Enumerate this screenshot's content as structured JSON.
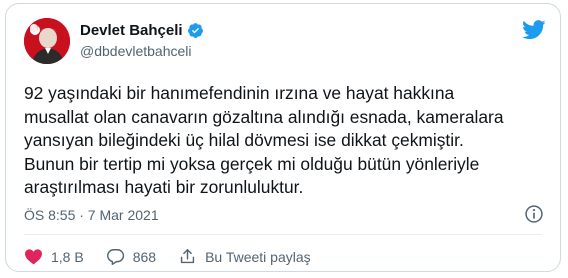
{
  "author": {
    "name": "Devlet Bahçeli",
    "handle": "@dbdevletbahceli"
  },
  "tweet": {
    "lines": [
      "92 yaşındaki bir hanımefendinin ırzına ve hayat hakkına",
      "musallat olan canavarın gözaltına alındığı esnada, kameralara",
      "yansıyan bileğindeki üç hilal dövmesi ise dikkat çekmiştir.",
      "Bunun bir tertip mi yoksa gerçek mi olduğu bütün yönleriyle",
      "araştırılması hayati bir zorunluluktur."
    ],
    "timestamp": "ÖS 8:55 · 7 Mar 2021"
  },
  "actions": {
    "likes": "1,8 B",
    "replies": "868",
    "share": "Bu Tweeti paylaş"
  },
  "colors": {
    "like": "#e0245e",
    "brand": "#1d9bf0",
    "avatar_bg": "#c8101e",
    "muted": "#536471"
  }
}
